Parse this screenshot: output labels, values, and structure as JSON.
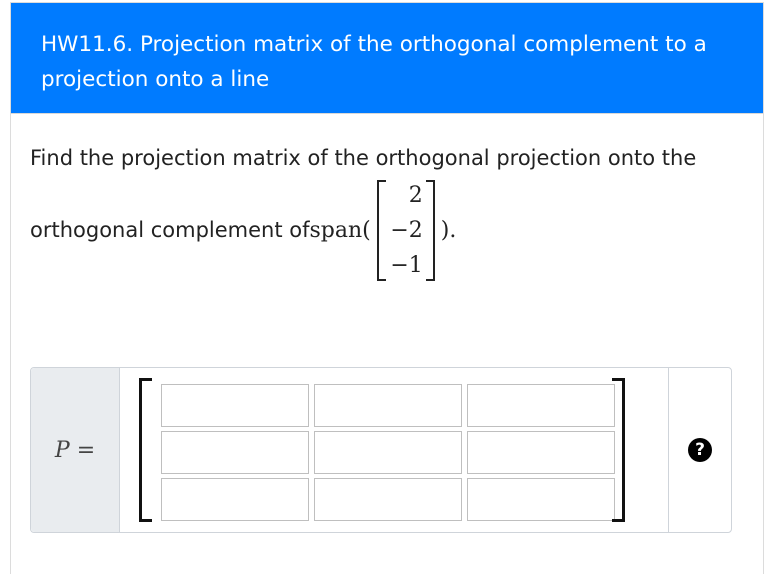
{
  "question": {
    "title": "HW11.6. Projection matrix of the orthogonal complement to a projection onto a line",
    "prompt_line1": "Find the projection matrix of the orthogonal projection onto the",
    "prompt_line2_before": "orthogonal complement of ",
    "span_text": "span(",
    "close_text": ").",
    "vector": [
      "2",
      "−2",
      "−1"
    ]
  },
  "answer": {
    "label": "P",
    "equals": "=",
    "matrix_rows": 3,
    "matrix_cols": 3,
    "values": [
      "",
      "",
      "",
      "",
      "",
      "",
      "",
      "",
      ""
    ]
  },
  "help": {
    "icon": "question-circle-icon",
    "glyph": "?"
  }
}
